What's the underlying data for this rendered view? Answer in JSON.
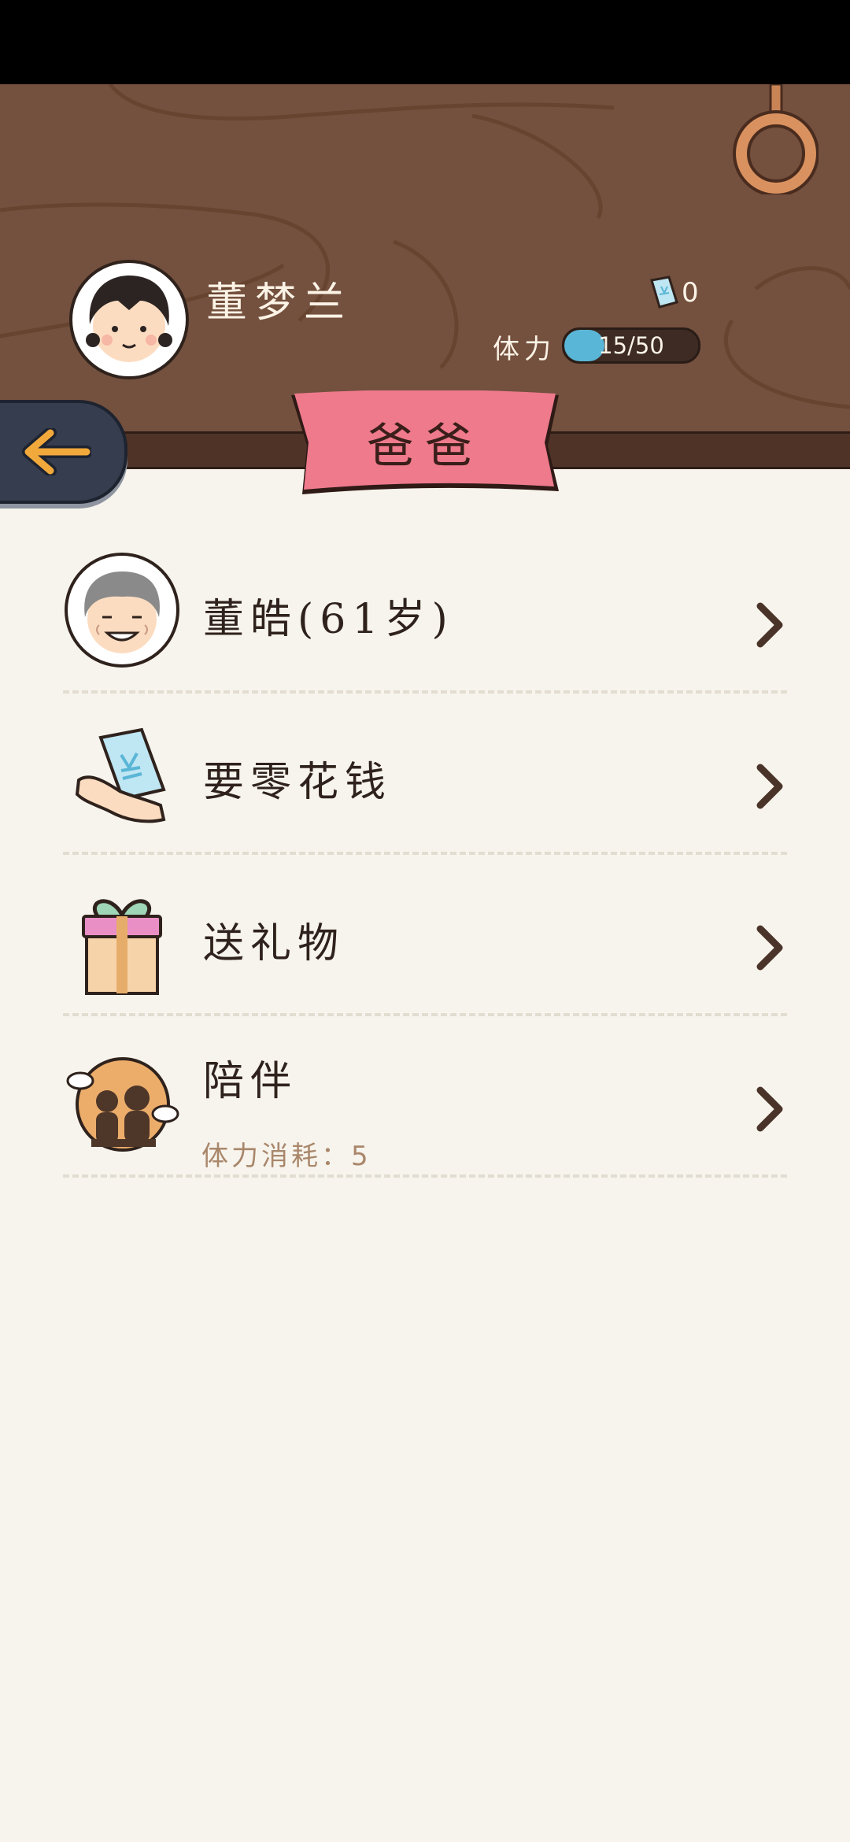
{
  "header": {
    "player_name": "董梦兰",
    "ticket_count": "0",
    "stamina_label": "体力",
    "stamina_text": "15/50",
    "stamina_fraction": 0.3
  },
  "page_title": "爸爸",
  "menu": [
    {
      "label": "董皓(61岁)",
      "icon": "grandpa-avatar-icon"
    },
    {
      "label": "要零花钱",
      "icon": "money-hand-icon"
    },
    {
      "label": "送礼物",
      "icon": "gift-box-icon"
    },
    {
      "label": "陪伴",
      "sub": "体力消耗：5",
      "icon": "companion-icon"
    }
  ],
  "colors": {
    "header_wood": "#74503e",
    "banner_pink": "#ee7a8c",
    "stamina_blue": "#5ab6d6",
    "back_button": "#353d4e",
    "arrow_orange": "#f2a93b"
  }
}
